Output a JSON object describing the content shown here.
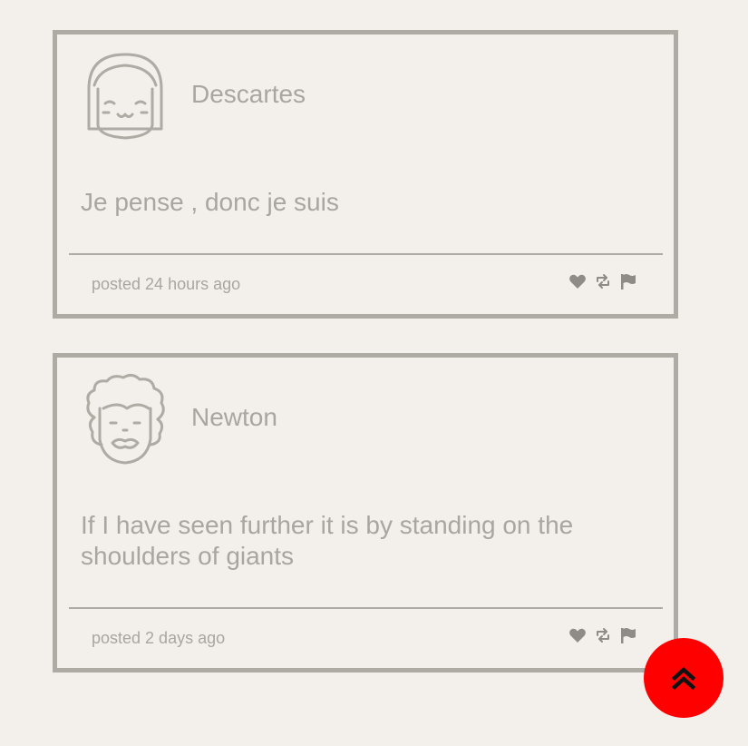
{
  "posts": [
    {
      "author": "Descartes",
      "avatar_icon": "girl-face-icon",
      "quote": "Je pense , donc je suis",
      "posted": "posted 24 hours ago",
      "actions": [
        "heart-icon",
        "retweet-icon",
        "flag-icon"
      ]
    },
    {
      "author": "Newton",
      "avatar_icon": "curly-hair-face-icon",
      "quote": "If I have seen further it is by standing on the shoulders of giants",
      "posted": "posted 2 days ago",
      "actions": [
        "heart-icon",
        "retweet-icon",
        "flag-icon"
      ]
    }
  ],
  "scroll_top_button": {
    "icon": "double-chevron-up-icon",
    "color": "#ff0000"
  },
  "colors": {
    "background": "#f3f0eb",
    "border": "#aeaaa4",
    "text": "#a9a5a0",
    "icon": "#8f8b86"
  }
}
